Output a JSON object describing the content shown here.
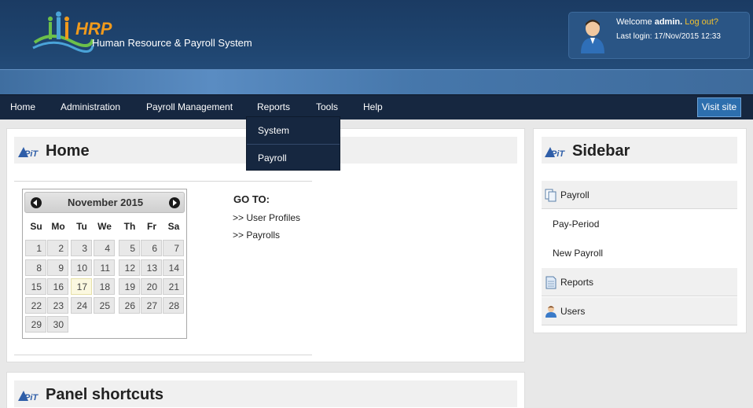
{
  "header": {
    "logo_text": "HRP",
    "logo_subtitle": "Human Resource & Payroll System",
    "welcome_prefix": "Welcome",
    "username": "admin.",
    "logout_label": "Log out?",
    "last_login": "Last login: 17/Nov/2015 12:33"
  },
  "nav": {
    "items": [
      {
        "label": "Home"
      },
      {
        "label": "Administration"
      },
      {
        "label": "Payroll Management"
      },
      {
        "label": "Reports"
      },
      {
        "label": "Tools"
      },
      {
        "label": "Help"
      }
    ],
    "visit_site_label": "Visit site",
    "reports_dropdown": [
      {
        "label": "System"
      },
      {
        "label": "Payroll"
      }
    ]
  },
  "home_panel": {
    "title": "Home",
    "calendar": {
      "month_label": "November 2015",
      "weekdays": [
        "Su",
        "Mo",
        "Tu",
        "We",
        "Th",
        "Fr",
        "Sa"
      ],
      "days": [
        "1",
        "2",
        "3",
        "4",
        "5",
        "6",
        "7",
        "8",
        "9",
        "10",
        "11",
        "12",
        "13",
        "14",
        "15",
        "16",
        "17",
        "18",
        "19",
        "20",
        "21",
        "22",
        "23",
        "24",
        "25",
        "26",
        "27",
        "28",
        "29",
        "30"
      ],
      "today": "17"
    },
    "goto": {
      "title": "GO TO:",
      "links": [
        {
          "label": ">> User Profiles"
        },
        {
          "label": ">> Payrolls"
        }
      ]
    }
  },
  "shortcuts_panel": {
    "title": "Panel shortcuts"
  },
  "sidebar": {
    "title": "Sidebar",
    "items": [
      {
        "label": "Payroll",
        "icon": "pages-icon"
      },
      {
        "label": "Pay-Period"
      },
      {
        "label": "New Payroll"
      },
      {
        "label": "Reports",
        "icon": "document-icon"
      },
      {
        "label": "Users",
        "icon": "user-icon"
      }
    ]
  },
  "colors": {
    "header_bg": "#1f4570",
    "nav_bg": "#162740",
    "logo_orange": "#f09a1c",
    "logout_yellow": "#f0c030",
    "visit_button": "#2d6fae"
  }
}
